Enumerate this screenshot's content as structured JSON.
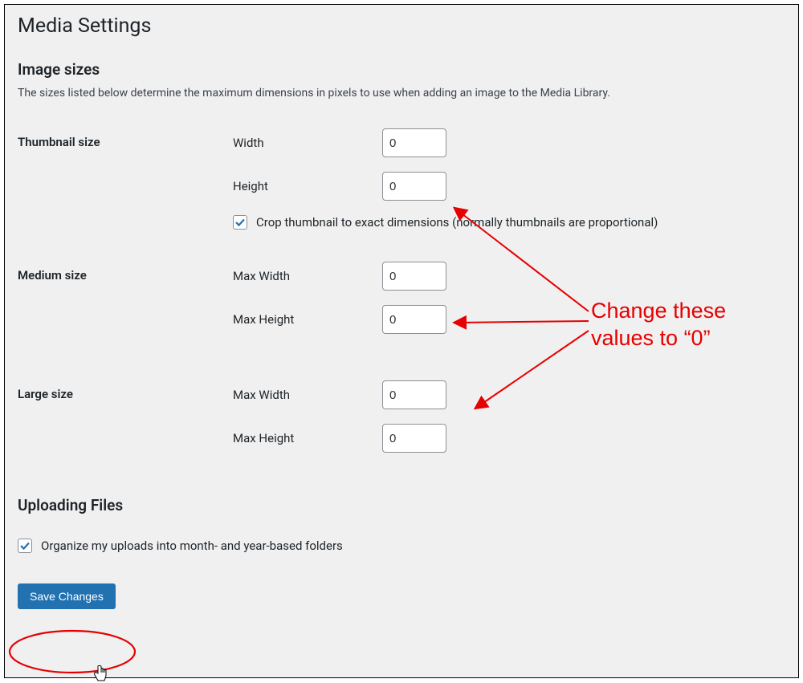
{
  "page": {
    "title": "Media Settings"
  },
  "image_sizes": {
    "heading": "Image sizes",
    "description": "The sizes listed below determine the maximum dimensions in pixels to use when adding an image to the Media Library."
  },
  "thumbnail": {
    "label": "Thumbnail size",
    "width_label": "Width",
    "width_value": "0",
    "height_label": "Height",
    "height_value": "0",
    "crop_label": "Crop thumbnail to exact dimensions (normally thumbnails are proportional)",
    "crop_checked": true
  },
  "medium": {
    "label": "Medium size",
    "max_width_label": "Max Width",
    "max_width_value": "0",
    "max_height_label": "Max Height",
    "max_height_value": "0"
  },
  "large": {
    "label": "Large size",
    "max_width_label": "Max Width",
    "max_width_value": "0",
    "max_height_label": "Max Height",
    "max_height_value": "0"
  },
  "uploading": {
    "heading": "Uploading Files",
    "organize_label": "Organize my uploads into month- and year-based folders",
    "organize_checked": true
  },
  "submit": {
    "label": "Save Changes"
  },
  "annotation": {
    "line1": "Change these",
    "line2": "values to “0”"
  },
  "colors": {
    "accent": "#2271b1",
    "annotation_red": "#e60000"
  }
}
